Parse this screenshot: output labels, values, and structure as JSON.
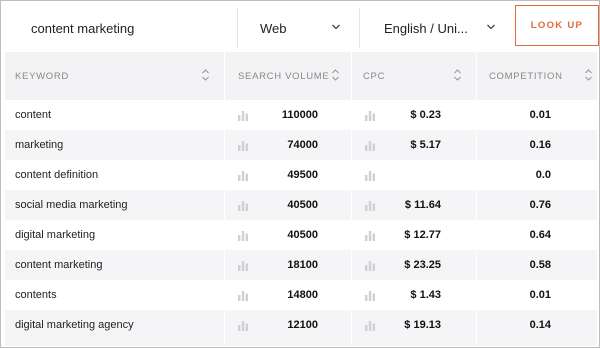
{
  "search": {
    "query": "content marketing"
  },
  "filters": {
    "source": "Web",
    "language": "English / Uni..."
  },
  "actions": {
    "lookup_label": "LOOK UP"
  },
  "table": {
    "headers": [
      "KEYWORD",
      "SEARCH VOLUME",
      "CPC",
      "COMPETITION"
    ],
    "rows": [
      {
        "keyword": "content",
        "volume": "110000",
        "cpc": "$ 0.23",
        "competition": "0.01"
      },
      {
        "keyword": "marketing",
        "volume": "74000",
        "cpc": "$ 5.17",
        "competition": "0.16"
      },
      {
        "keyword": "content definition",
        "volume": "49500",
        "cpc": "",
        "competition": "0.0"
      },
      {
        "keyword": "social media marketing",
        "volume": "40500",
        "cpc": "$ 11.64",
        "competition": "0.76"
      },
      {
        "keyword": "digital marketing",
        "volume": "40500",
        "cpc": "$ 12.77",
        "competition": "0.64"
      },
      {
        "keyword": "content marketing",
        "volume": "18100",
        "cpc": "$ 23.25",
        "competition": "0.58"
      },
      {
        "keyword": "contents",
        "volume": "14800",
        "cpc": "$ 1.43",
        "competition": "0.01"
      },
      {
        "keyword": "digital marketing agency",
        "volume": "12100",
        "cpc": "$ 19.13",
        "competition": "0.14"
      }
    ]
  },
  "colors": {
    "accent": "#e06a3c",
    "header_bg": "#f3f3f5",
    "row_alt": "#f5f5f7"
  },
  "icons": {
    "dropdown": "chevron-down-icon",
    "sort": "sort-arrows-icon",
    "trend": "bar-chart-icon"
  }
}
